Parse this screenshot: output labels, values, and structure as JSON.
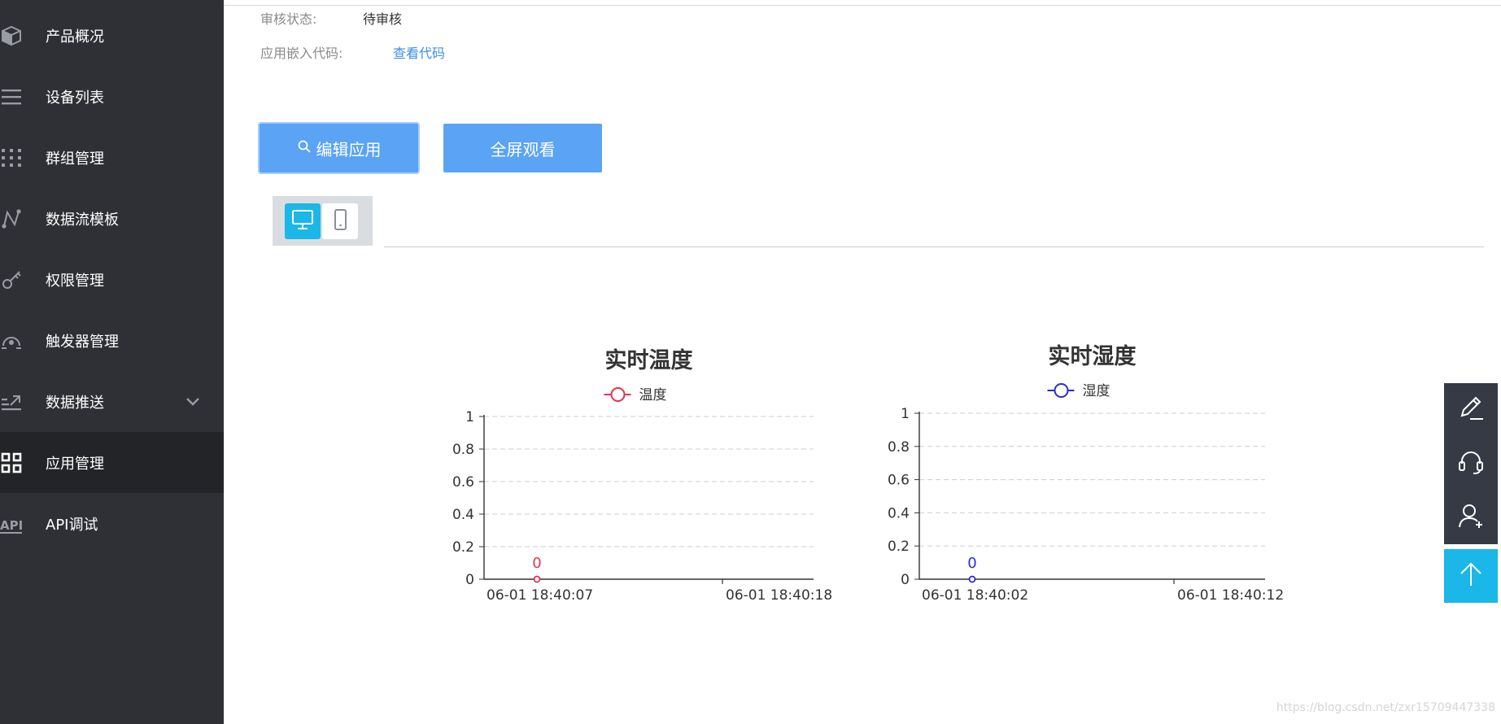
{
  "sidebar": {
    "items": [
      {
        "label": "产品概况",
        "icon": "cube-icon"
      },
      {
        "label": "设备列表",
        "icon": "list-icon"
      },
      {
        "label": "群组管理",
        "icon": "grid-dots-icon"
      },
      {
        "label": "数据流模板",
        "icon": "dataflow-icon"
      },
      {
        "label": "权限管理",
        "icon": "key-icon"
      },
      {
        "label": "触发器管理",
        "icon": "trigger-icon"
      },
      {
        "label": "数据推送",
        "icon": "push-icon",
        "expandable": true
      },
      {
        "label": "应用管理",
        "icon": "apps-icon",
        "active": true
      },
      {
        "label": "API调试",
        "icon": "api-icon"
      }
    ]
  },
  "app_info": {
    "review_label": "审核状态:",
    "review_value": "待审核",
    "embed_label": "应用嵌入代码:",
    "embed_link": "查看代码"
  },
  "actions": {
    "edit_label": "编辑应用",
    "fullscreen_label": "全屏观看"
  },
  "view_toggle": {
    "desktop_icon": "desktop-icon",
    "mobile_icon": "mobile-icon",
    "selected": "desktop"
  },
  "colors": {
    "sidebar_bg": "#2f3036",
    "active_bg": "#232427",
    "button": "#5aa3f5",
    "accent": "#1ab7e8",
    "temp_series": "#e8304f",
    "humidity_series": "#2b2bd6",
    "float_bar": "#353a45"
  },
  "chart_data": [
    {
      "type": "line",
      "title": "实时温度",
      "x": [
        "06-01 18:40:07",
        "06-01 18:40:18"
      ],
      "series": [
        {
          "name": "温度",
          "values": [
            0
          ],
          "color": "#e8304f"
        }
      ],
      "ylim": [
        0,
        1
      ],
      "yticks": [
        "0",
        "0.2",
        "0.4",
        "0.6",
        "0.8",
        "1"
      ],
      "grid": true,
      "legend": "top-center"
    },
    {
      "type": "line",
      "title": "实时湿度",
      "x": [
        "06-01 18:40:02",
        "06-01 18:40:12"
      ],
      "series": [
        {
          "name": "湿度",
          "values": [
            0
          ],
          "color": "#2b2bd6"
        }
      ],
      "ylim": [
        0,
        1
      ],
      "yticks": [
        "0",
        "0.2",
        "0.4",
        "0.6",
        "0.8",
        "1"
      ],
      "grid": true,
      "legend": "top-center"
    }
  ],
  "float_toolbar": {
    "items": [
      "edit-icon",
      "headset-icon",
      "add-user-icon"
    ],
    "top_button": "arrow-up-icon"
  },
  "watermark": "https://blog.csdn.net/zxr15709447338"
}
